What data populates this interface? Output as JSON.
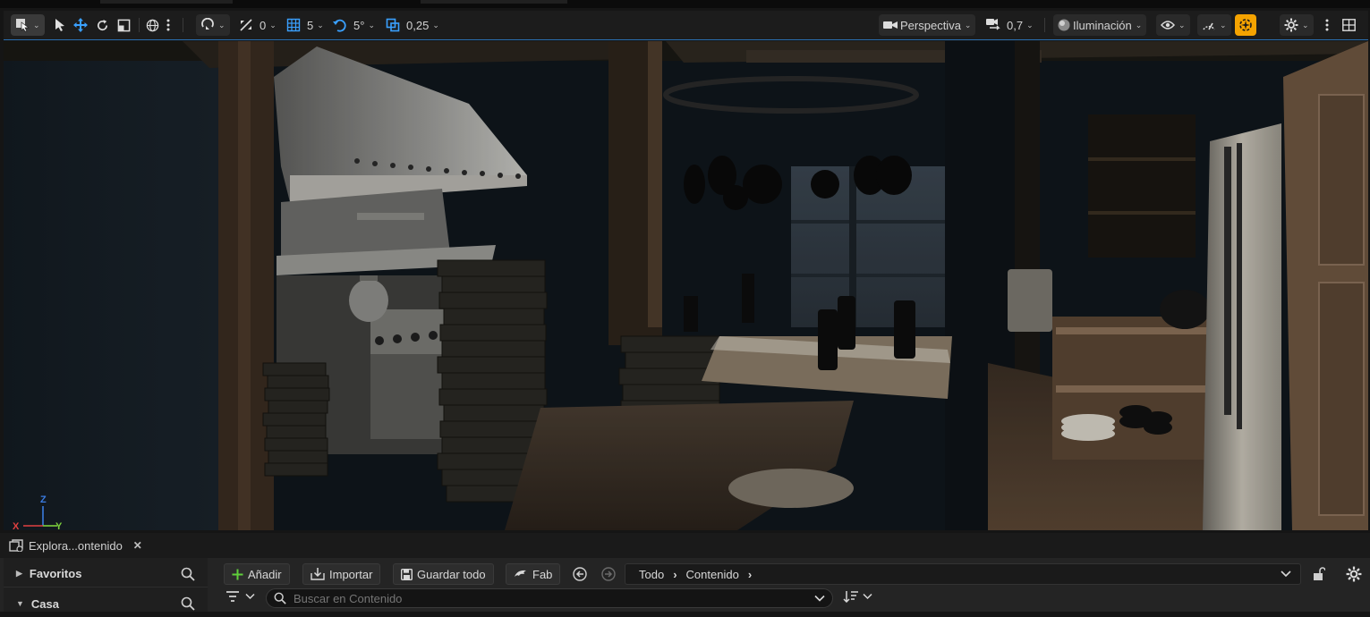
{
  "toolbar": {
    "select_mode_icon": "select-mode-icon",
    "translate_snap_value": "0",
    "grid_snap_value": "5",
    "rotate_snap_value": "5°",
    "scale_snap_value": "0,25",
    "view_mode_label": "Perspectiva",
    "camera_speed_value": "0,7",
    "lighting_label": "Iluminación",
    "accent_color": "#f5a300",
    "border_accent": "#2a6fb0"
  },
  "viewport": {
    "axis": {
      "x_label": "X",
      "y_label": "Y",
      "z_label": "Z",
      "x_color": "#e04040",
      "y_color": "#7ccf3c",
      "z_color": "#3a7be0"
    }
  },
  "content_browser": {
    "tab_label": "Explora...ontenido",
    "favorites_label": "Favoritos",
    "home_label": "Casa",
    "add_label": "Añadir",
    "import_label": "Importar",
    "save_all_label": "Guardar todo",
    "fab_label": "Fab",
    "breadcrumbs": [
      "Todo",
      "Contenido"
    ],
    "search_placeholder": "Buscar en Contenido"
  }
}
